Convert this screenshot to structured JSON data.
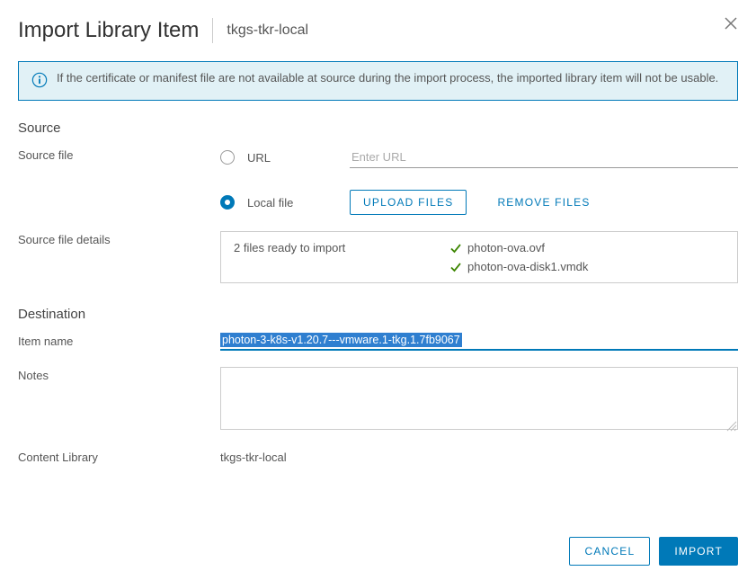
{
  "header": {
    "title": "Import Library Item",
    "subtitle": "tkgs-tkr-local"
  },
  "info_banner": "If the certificate or manifest file are not available at source during the import process, the imported library item will not be usable.",
  "source": {
    "heading": "Source",
    "file_label": "Source file",
    "url_label": "URL",
    "url_placeholder": "Enter URL",
    "url_value": "",
    "local_file_label": "Local file",
    "upload_button": "UPLOAD FILES",
    "remove_button": "REMOVE FILES",
    "details_label": "Source file details",
    "details_summary": "2 files ready to import",
    "files": [
      "photon-ova.ovf",
      "photon-ova-disk1.vmdk"
    ]
  },
  "destination": {
    "heading": "Destination",
    "item_name_label": "Item name",
    "item_name_value": "photon-3-k8s-v1.20.7---vmware.1-tkg.1.7fb9067",
    "notes_label": "Notes",
    "notes_value": "",
    "content_library_label": "Content Library",
    "content_library_value": "tkgs-tkr-local"
  },
  "footer": {
    "cancel": "CANCEL",
    "import": "IMPORT"
  }
}
